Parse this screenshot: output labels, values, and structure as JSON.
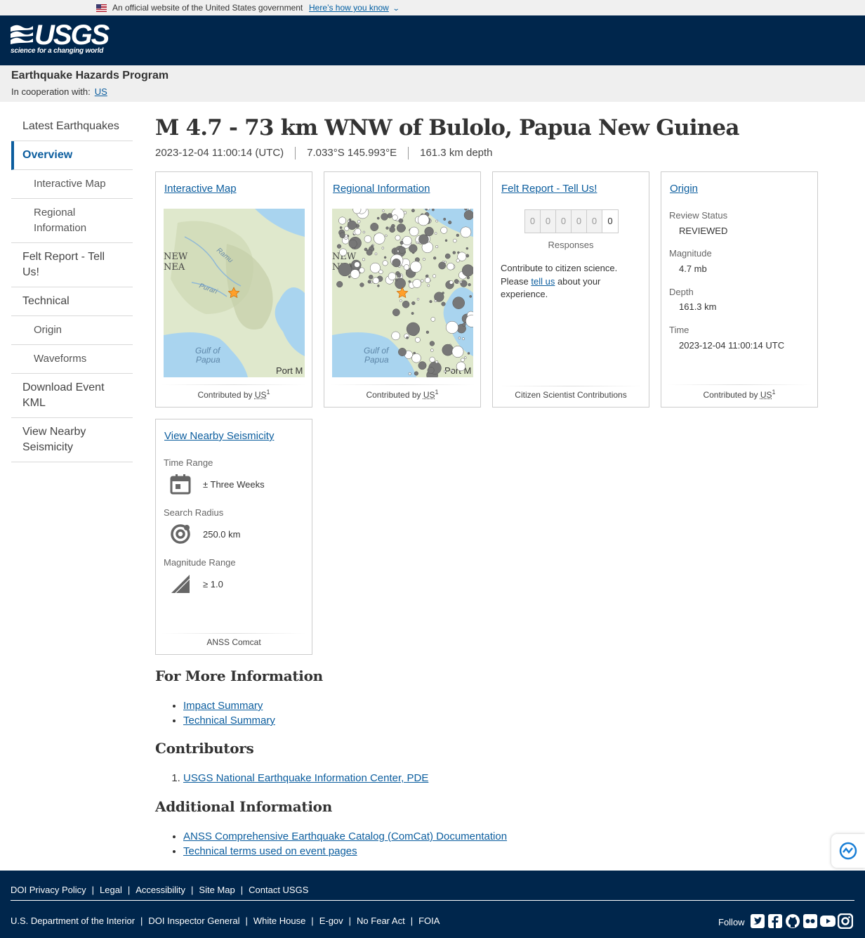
{
  "gov_banner": {
    "text": "An official website of the United States government",
    "how": "Here’s how you know"
  },
  "header": {
    "logo": "USGS",
    "tagline": "science for a changing world"
  },
  "program": {
    "title": "Earthquake Hazards Program",
    "coop_label": "In cooperation with:",
    "coop_link": "US"
  },
  "nav": {
    "latest": "Latest Earthquakes",
    "overview": "Overview",
    "interactive_map": "Interactive Map",
    "regional": "Regional Information",
    "felt": "Felt Report - Tell Us!",
    "technical": "Technical",
    "origin": "Origin",
    "waveforms": "Waveforms",
    "kml": "Download Event KML",
    "nearby": "View Nearby Seismicity"
  },
  "event": {
    "title": "M 4.7 - 73 km WNW of Bulolo, Papua New Guinea",
    "time": "2023-12-04 11:00:14 (UTC)",
    "coords": "7.033°S 145.993°E",
    "depth": "161.3 km depth"
  },
  "cards": {
    "map": {
      "title": "Interactive Map",
      "foot": "Contributed by",
      "src": "US",
      "sup": "1",
      "labels": {
        "ramu": "Ramu",
        "purari": "Purari",
        "gulf1": "Gulf of",
        "gulf2": "Papua",
        "port": "Port M",
        "new": "NEW",
        "nea": "NEA"
      }
    },
    "regional": {
      "title": "Regional Information",
      "foot": "Contributed by",
      "src": "US",
      "sup": "1"
    },
    "felt": {
      "title": "Felt Report - Tell Us!",
      "digits": [
        "0",
        "0",
        "0",
        "0",
        "0",
        "0"
      ],
      "responses": "Responses",
      "text1": "Contribute to citizen science. Please ",
      "link": "tell us",
      "text2": " about your experience.",
      "foot": "Citizen Scientist Contributions"
    },
    "origin": {
      "title": "Origin",
      "review_label": "Review Status",
      "review": "REVIEWED",
      "mag_label": "Magnitude",
      "mag": "4.7 mb",
      "depth_label": "Depth",
      "depth": "161.3 km",
      "time_label": "Time",
      "time": "2023-12-04 11:00:14 UTC",
      "foot": "Contributed by",
      "src": "US",
      "sup": "1"
    },
    "seismicity": {
      "title": "View Nearby Seismicity",
      "time_label": "Time Range",
      "time": "± Three Weeks",
      "radius_label": "Search Radius",
      "radius": "250.0 km",
      "mag_label": "Magnitude Range",
      "mag": "≥ 1.0",
      "foot": "ANSS Comcat"
    }
  },
  "more_info": {
    "heading": "For More Information",
    "items": [
      "Impact Summary",
      "Technical Summary"
    ]
  },
  "contributors": {
    "heading": "Contributors",
    "items": [
      "USGS National Earthquake Information Center, PDE"
    ]
  },
  "additional": {
    "heading": "Additional Information",
    "items": [
      "ANSS Comprehensive Earthquake Catalog (ComCat) Documentation",
      "Technical terms used on event pages"
    ]
  },
  "footer": {
    "links1": [
      "DOI Privacy Policy",
      "Legal",
      "Accessibility",
      "Site Map",
      "Contact USGS"
    ],
    "links2": [
      "U.S. Department of the Interior",
      "DOI Inspector General",
      "White House",
      "E-gov",
      "No Fear Act",
      "FOIA"
    ],
    "follow": "Follow",
    "social": [
      "twitter-icon",
      "facebook-icon",
      "github-icon",
      "flickr-icon",
      "youtube-icon",
      "instagram-icon"
    ]
  },
  "colors": {
    "header_bg": "#00264c",
    "link": "#0b5d9e",
    "nav_active": "#0b5d9e"
  }
}
